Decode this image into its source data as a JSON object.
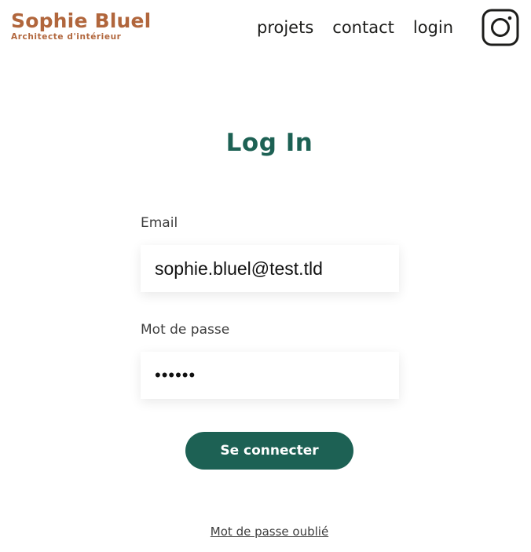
{
  "header": {
    "logo_title": "Sophie Bluel",
    "logo_subtitle": "Architecte d'intérieur",
    "nav": {
      "projets": "projets",
      "contact": "contact",
      "login": "login"
    },
    "social_icon": "instagram-icon"
  },
  "login": {
    "title": "Log In",
    "email_label": "Email",
    "email_value": "sophie.bluel@test.tld",
    "password_label": "Mot de passe",
    "password_value": "******",
    "submit_label": "Se connecter",
    "forgot_label": "Mot de passe oublié"
  },
  "colors": {
    "brand": "#b1663c",
    "accent": "#1d6154",
    "text": "#1d1d1b"
  }
}
